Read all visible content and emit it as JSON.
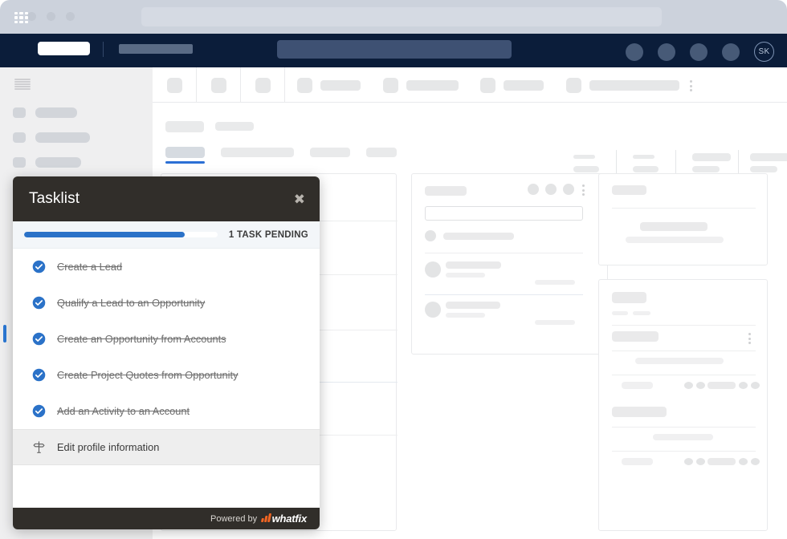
{
  "browser": {
    "window_dots": [
      "close",
      "minimize",
      "maximize"
    ],
    "url_placeholder": ""
  },
  "appbar": {
    "waffle_icon": "grid-apps-icon",
    "search_placeholder": "",
    "icons": [
      "icon-1",
      "icon-2",
      "icon-3",
      "icon-4"
    ],
    "avatar_initials": "SK"
  },
  "sidebar": {
    "menu_icon": "hamburger-icon",
    "items": [
      {
        "label": ""
      },
      {
        "label": ""
      },
      {
        "label": ""
      }
    ]
  },
  "main": {
    "toolbar_kebab": "more-vertical-icon",
    "active_tab_index": 0
  },
  "tasklist": {
    "title": "Tasklist",
    "close_label": "✖",
    "progress_percent": 83,
    "pending_label": "1 TASK PENDING",
    "accent_color": "#2b72c8",
    "header_color": "#312e2a",
    "items": [
      {
        "label": "Create a Lead",
        "status": "done",
        "icon": "check-circle-icon"
      },
      {
        "label": "Qualify a Lead to an Opportunity",
        "status": "done",
        "icon": "check-circle-icon"
      },
      {
        "label": "Create an Opportunity from Accounts",
        "status": "done",
        "icon": "check-circle-icon"
      },
      {
        "label": "Create Project Quotes from Opportunity",
        "status": "done",
        "icon": "check-circle-icon"
      },
      {
        "label": "Add an Activity to an Account",
        "status": "done",
        "icon": "check-circle-icon"
      },
      {
        "label": "Edit profile information",
        "status": "pending",
        "icon": "signpost-icon"
      }
    ],
    "footer": {
      "powered_by": "Powered by",
      "brand": "whatfix",
      "brand_color": "#f26522"
    }
  }
}
